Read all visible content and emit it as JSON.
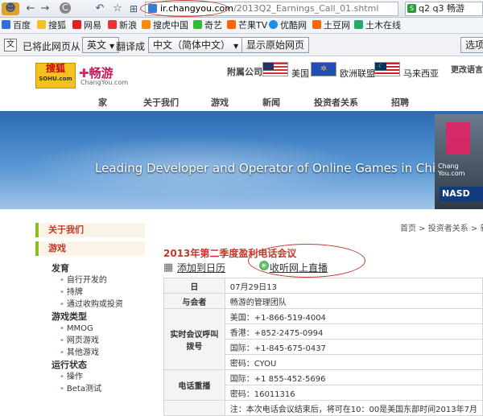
{
  "browser": {
    "url_domain": "ir.changyou.com",
    "url_path": "/2013Q2_Earnings_Call_01.shtml",
    "search_text": "q2 q3 畅游"
  },
  "bookmarks": [
    "百度",
    "搜狐",
    "网易",
    "新浪",
    "搜虎中国",
    "奇艺",
    "芒果TV",
    "优酷网",
    "土豆网",
    "土木在线"
  ],
  "translate_bar": {
    "prefix": "已将此网页从",
    "from_lang": "英文",
    "mid": "翻译成",
    "to_lang": "中文（简体中文）",
    "show_original": "显示原始网页",
    "options": "选项"
  },
  "site": {
    "logo_sohu": "搜狐",
    "logo_sohu_sub": "SOHU.com",
    "logo_changyou": "畅游",
    "logo_changyou_sub": "ChangYou.com",
    "affiliate_label": "附属公司",
    "regions": [
      "美国",
      "欧洲联盟",
      "马来西亚"
    ],
    "change_language": "更改语言",
    "nav": [
      "家",
      "关于我们",
      "游戏",
      "新闻",
      "投资者关系",
      "招聘"
    ],
    "tagline": "Leading Developer and Operator of Online Games in China",
    "banner_sign": "Chang You.com",
    "banner_nasdaq": "NASD"
  },
  "sidebar": {
    "headers": [
      "关于我们",
      "游戏"
    ],
    "groups": [
      {
        "title": "发育",
        "items": [
          "自行开发的",
          "持牌",
          "通过收购或投资"
        ]
      },
      {
        "title": "游戏类型",
        "items": [
          "MMOG",
          "网页游戏",
          "其他游戏"
        ]
      },
      {
        "title": "运行状态",
        "items": [
          "操作",
          "Beta测试"
        ]
      }
    ]
  },
  "breadcrumb": "首页 > 投资者关系 > 新闻",
  "content": {
    "title": "2013年第二季度盈利电话会议",
    "add_calendar": "添加到日历",
    "listen_live": "收听网上直播",
    "rows": [
      {
        "key": "日",
        "values": [
          "07月29日13"
        ]
      },
      {
        "key": "与会者",
        "values": [
          "畅游的管理团队"
        ]
      },
      {
        "key": "实时会议呼叫拨号",
        "values": [
          "美国：+1-866-519-4004",
          "香港：+852-2475-0994",
          "国际：+1-845-675-0437",
          "密码：CYOU"
        ]
      },
      {
        "key": "电话重播",
        "values": [
          "国际：+1 855-452-5696",
          "密码：16011316"
        ]
      },
      {
        "key": "",
        "values": [
          "注：本次电话会议结束后，将可在10：00是美国东部时间2013年7月"
        ]
      }
    ]
  },
  "colors": {
    "accent_red": "#c0392b",
    "nav_green": "#8bbb29",
    "banner_blue": "#2a6ab3"
  }
}
